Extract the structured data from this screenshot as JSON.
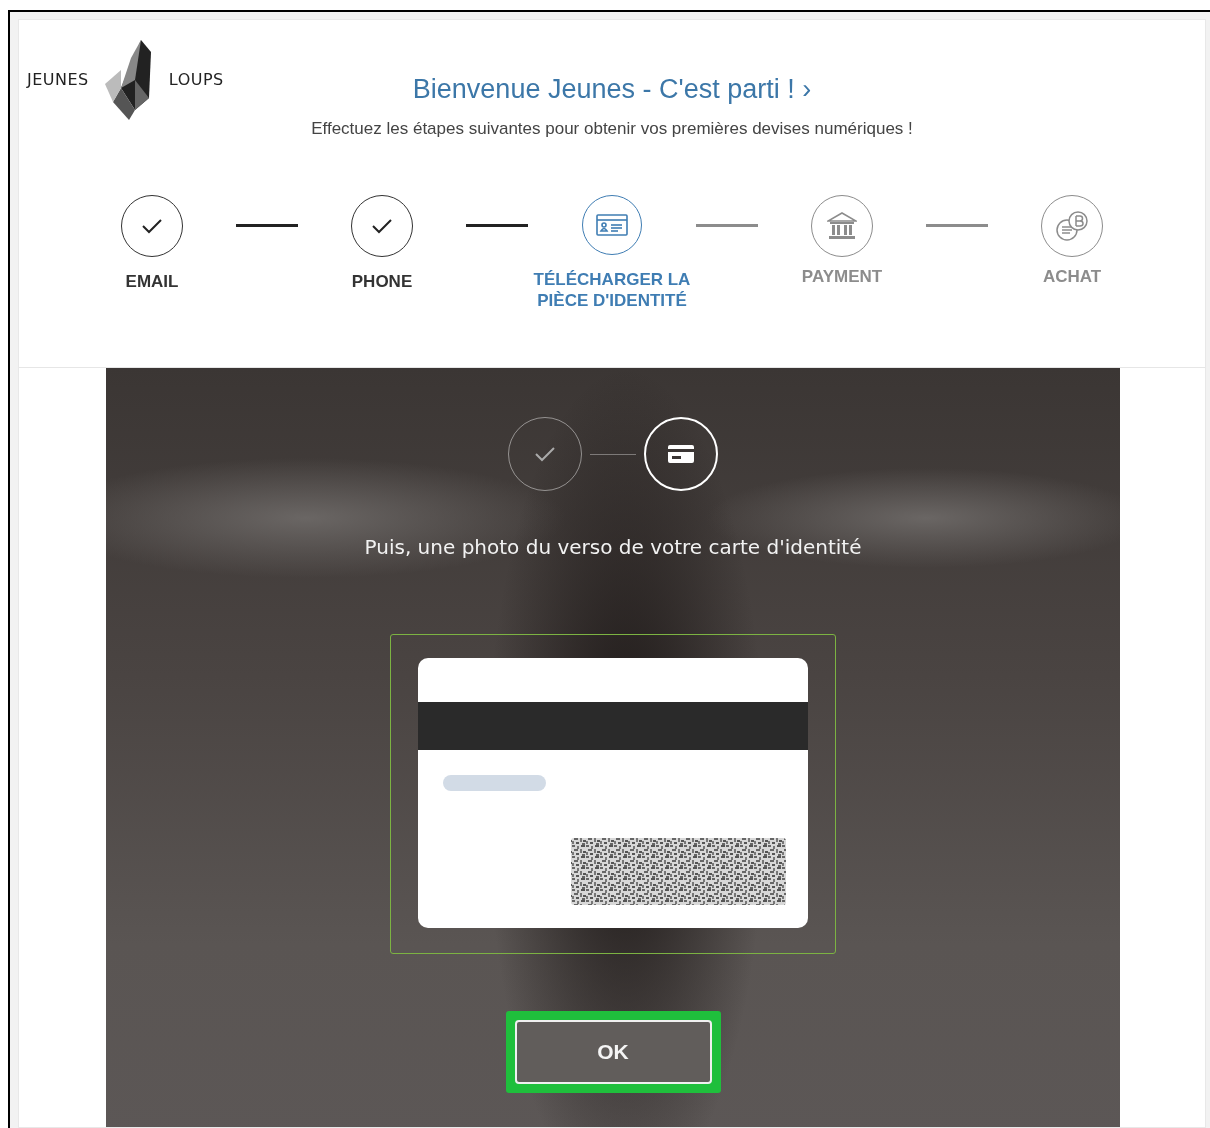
{
  "logo": {
    "left_word": "JEUNES",
    "right_word": "LOUPS"
  },
  "header": {
    "title": "Bienvenue Jeunes - C'est parti ! ›",
    "subtitle": "Effectuez les étapes suivantes pour obtenir vos premières devises numériques !"
  },
  "steps": [
    {
      "label": "EMAIL",
      "kind": "check",
      "done": true,
      "selected": false
    },
    {
      "label": "PHONE",
      "kind": "check",
      "done": true,
      "selected": false
    },
    {
      "label": "TÉLÉCHARGER LA PIÈCE D'IDENTITÉ",
      "kind": "idcard",
      "done": false,
      "selected": true
    },
    {
      "label": "PAYMENT",
      "kind": "bank",
      "done": false,
      "selected": false
    },
    {
      "label": "ACHAT",
      "kind": "coins",
      "done": false,
      "selected": false
    }
  ],
  "capture": {
    "substeps": [
      {
        "kind": "check",
        "done": true,
        "selected": false
      },
      {
        "kind": "card",
        "done": false,
        "selected": true
      }
    ],
    "instruction": "Puis, une photo du verso de votre carte d'identité",
    "ok_button": {
      "label": "OK",
      "highlighted": true
    }
  }
}
